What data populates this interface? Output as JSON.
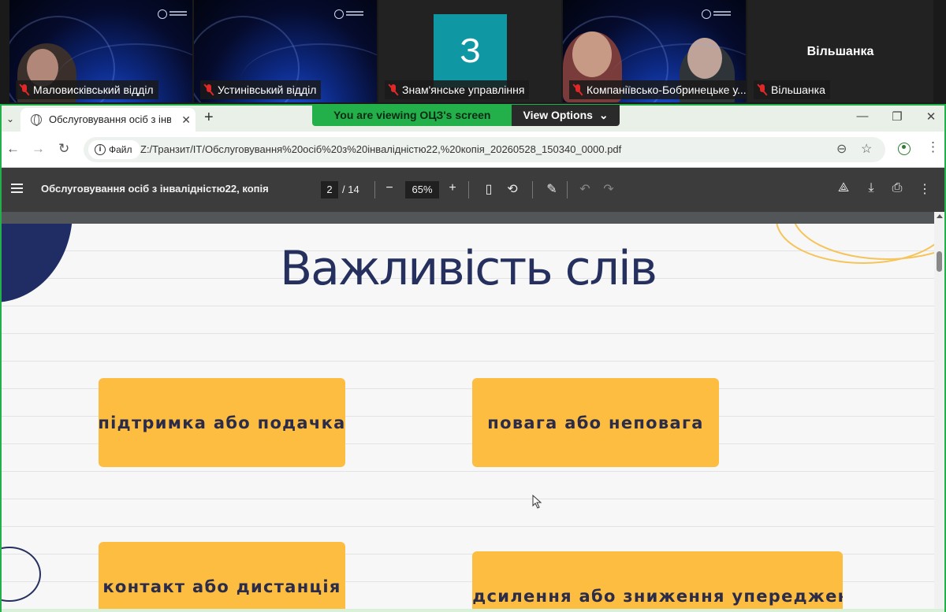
{
  "participants": [
    {
      "name": "Маловисківський відділ"
    },
    {
      "name": "Устинівський відділ"
    },
    {
      "name": "Знам'янське управління",
      "avatar_letter": "З"
    },
    {
      "name": "Компаніївсько-Бобринецьке у..."
    },
    {
      "name": "Вільшанка",
      "tile_label": "Вільшанка"
    }
  ],
  "share_banner": {
    "viewing_text": "You are viewing  ОЦЗ's screen",
    "options_label": "View Options",
    "accent_color": "#23b04b"
  },
  "browser": {
    "tab_title": "Обслуговування осіб з інвалідністю22, копія",
    "tab_title_visible": "Обслуговування осіб з інвалід",
    "file_chip": "Файл",
    "url": "Z:/Транзит/IT/Обслуговування%20осіб%20з%20інвалідністю22,%20копія_20260528_150340_0000.pdf"
  },
  "pdf_toolbar": {
    "doc_title": "Обслуговування осіб з інвалідністю22, копія",
    "current_page": "2",
    "total_pages": "/ 14",
    "zoom": "65%"
  },
  "slide": {
    "title": "Важливість слів",
    "cards": [
      "підтримка або подачка",
      "повага або неповага",
      "контакт або дистанція",
      "підсилення або зниження упереджень"
    ],
    "colors": {
      "card": "#fcbd40",
      "title": "#26305e",
      "blob": "#1f2d64"
    }
  }
}
